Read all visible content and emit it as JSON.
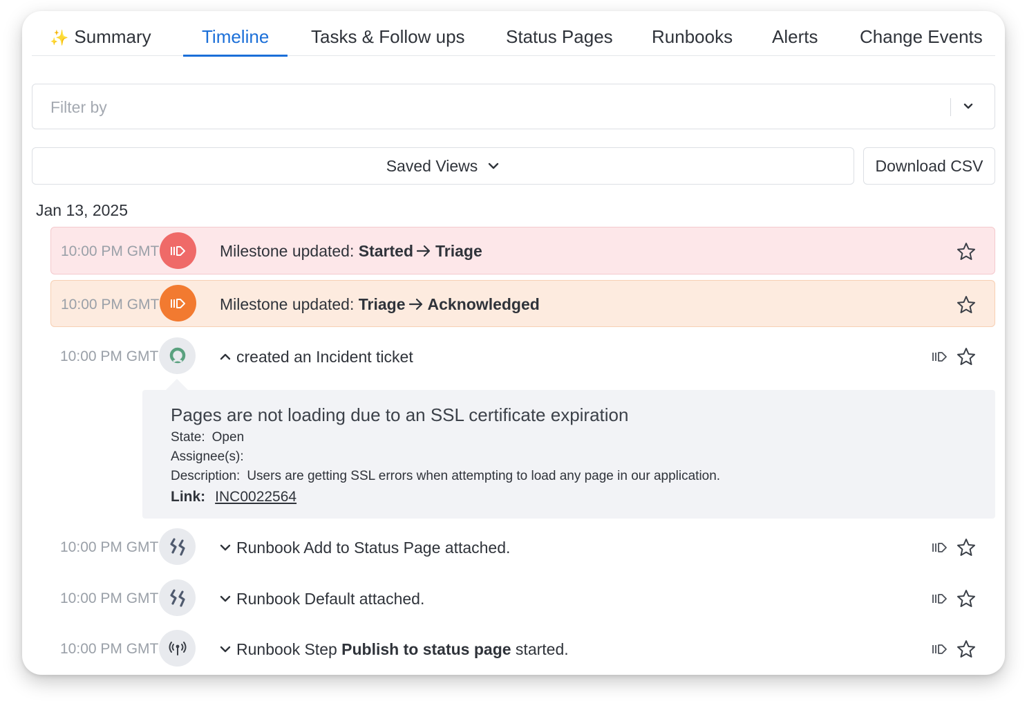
{
  "tabs": [
    {
      "label": "Summary",
      "icon": "sparkle-icon"
    },
    {
      "label": "Timeline",
      "active": true
    },
    {
      "label": "Tasks & Follow ups"
    },
    {
      "label": "Status Pages"
    },
    {
      "label": "Runbooks"
    },
    {
      "label": "Alerts"
    },
    {
      "label": "Change Events"
    }
  ],
  "filter": {
    "placeholder": "Filter by",
    "value": ""
  },
  "toolbar": {
    "saved_views_label": "Saved Views",
    "download_label": "Download CSV"
  },
  "date_heading": "Jan 13, 2025",
  "colors": {
    "accent": "#1b6fd8",
    "milestone_red": "#ef6a68",
    "milestone_orange": "#f27a30",
    "red_bg": "#fde7e9",
    "orange_bg": "#fdebdf"
  },
  "events": [
    {
      "time": "10:00 PM GMT",
      "icon": "milestone-icon",
      "prefix": "Milestone updated: ",
      "from": "Started",
      "to": "Triage"
    },
    {
      "time": "10:00 PM GMT",
      "icon": "milestone-icon",
      "prefix": "Milestone updated: ",
      "from": "Triage",
      "to": "Acknowledged"
    },
    {
      "time": "10:00 PM GMT",
      "icon": "servicenow-icon",
      "text": "created an Incident ticket",
      "expanded": true
    },
    {
      "time": "10:00 PM GMT",
      "icon": "runbook-icon",
      "text": "Runbook Add to Status Page attached."
    },
    {
      "time": "10:00 PM GMT",
      "icon": "runbook-icon",
      "text": "Runbook Default attached."
    },
    {
      "time": "10:00 PM GMT",
      "icon": "broadcast-icon",
      "prefix": "Runbook Step ",
      "bold": "Publish to status page",
      "suffix": " started."
    }
  ],
  "ticket": {
    "title": "Pages are not loading due to an SSL certificate expiration",
    "state_label": "State:",
    "state": "Open",
    "assignee_label": "Assignee(s):",
    "assignee": "",
    "description_label": "Description:",
    "description": "Users are getting SSL errors when attempting to load any page in our application.",
    "link_label": "Link:",
    "link_text": "INC0022564"
  }
}
